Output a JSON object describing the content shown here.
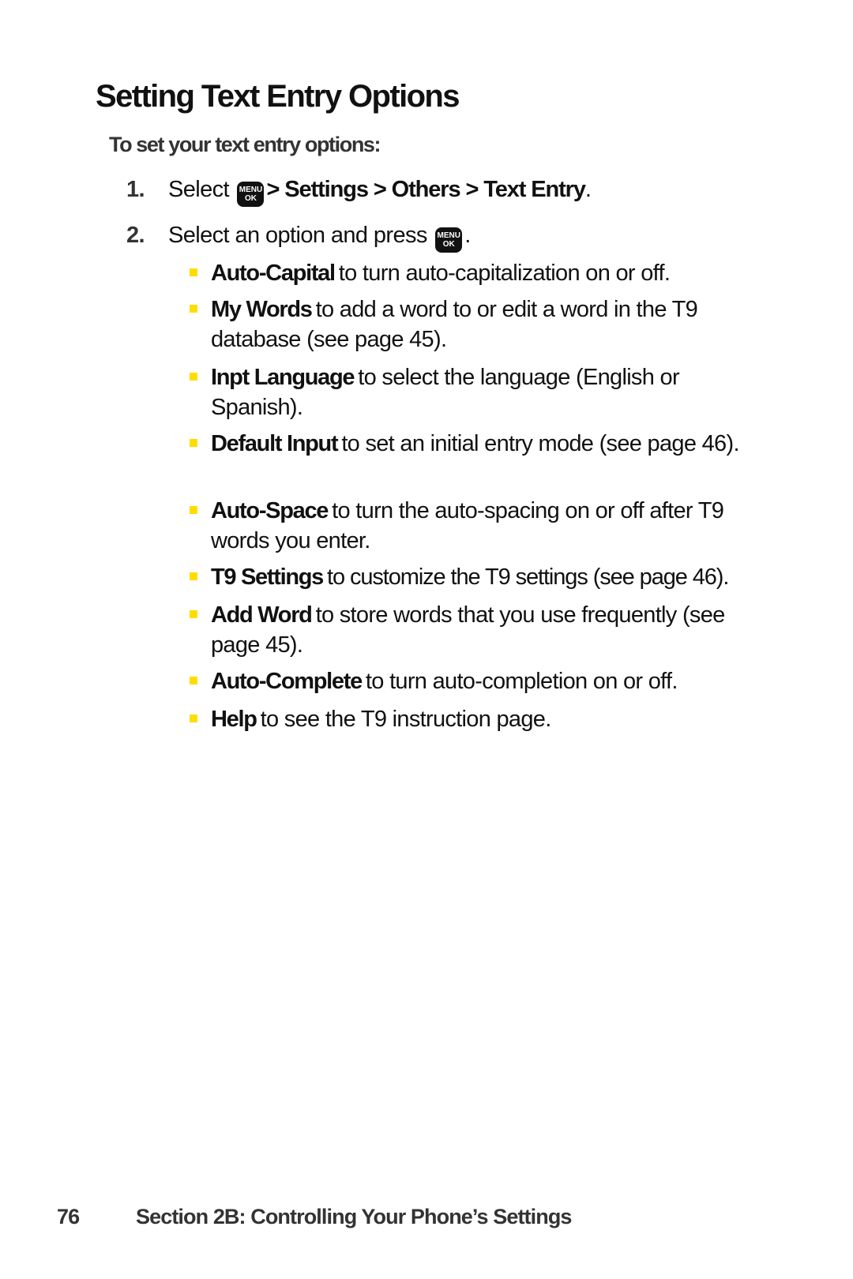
{
  "page": {
    "title": "Setting Text Entry Options",
    "subheading": "To set your text entry options:",
    "accent_color": "#FFDD00"
  },
  "steps": [
    {
      "number": "1.",
      "prefix": "Select",
      "icon": "menu-ok-key-icon",
      "icon_top": "MENU",
      "icon_bottom": "OK",
      "path": "> Settings > Others > Text Entry",
      "suffix": "."
    },
    {
      "number": "2.",
      "prefix": "Select an option and press",
      "icon": "menu-ok-key-icon",
      "icon_top": "MENU",
      "icon_bottom": "OK",
      "suffix": "."
    }
  ],
  "options": [
    {
      "term": "Auto-Capital",
      "desc": "to turn auto-capitalization on or off."
    },
    {
      "term": "My Words",
      "desc": "to add a word to or edit a word in the T9 database (see page 45)."
    },
    {
      "term": "Inpt Language",
      "desc": "to select the language (English or Spanish)."
    },
    {
      "term": "Default Input",
      "desc": "to set an initial entry mode (see page 46)."
    },
    {
      "term": "Auto-Space",
      "desc": "to turn the auto-spacing on or off after T9 words you enter."
    },
    {
      "term": "T9 Settings",
      "desc": "to customize the T9 settings (see page 46)."
    },
    {
      "term": "Add Word",
      "desc": "to store words that you use frequently (see page 45)."
    },
    {
      "term": "Auto-Complete",
      "desc": "to turn auto-completion on or off."
    },
    {
      "term": "Help",
      "desc": "to see the T9 instruction page."
    }
  ],
  "footer": {
    "page_number": "76",
    "section": "Section 2B: Controlling Your Phone’s Settings"
  }
}
